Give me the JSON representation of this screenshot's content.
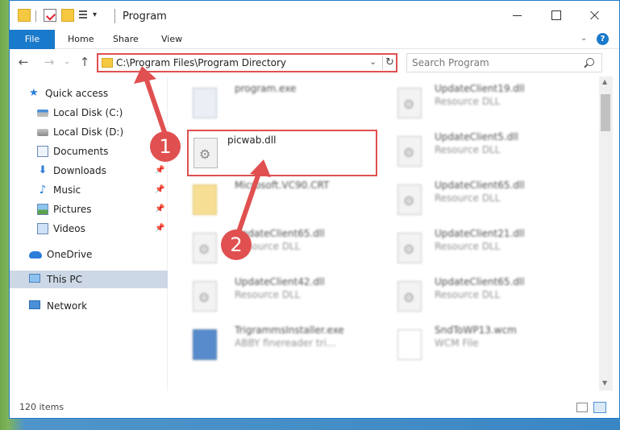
{
  "window": {
    "title": "Program",
    "quick_access_dropdown": "▾"
  },
  "ribbon": {
    "tabs": [
      {
        "label": "File"
      },
      {
        "label": "Home"
      },
      {
        "label": "Share"
      },
      {
        "label": "View"
      }
    ],
    "expand": "⌄",
    "help": "?"
  },
  "nav": {
    "back": "←",
    "forward": "→",
    "recent": "⌄",
    "up": "↑",
    "address": "C:\\Program Files\\Program Directory",
    "address_chevron": "⌄",
    "refresh": "↻",
    "search_placeholder": "Search Program"
  },
  "sidebar": {
    "items": [
      {
        "label": "Quick access",
        "icon": "star-icon"
      },
      {
        "label": "Local Disk (C:)",
        "icon": "disk-icon"
      },
      {
        "label": "Local Disk (D:)",
        "icon": "disk-icon"
      },
      {
        "label": "Documents",
        "icon": "documents-icon"
      },
      {
        "label": "Downloads",
        "icon": "downloads-icon",
        "pinned": "📌"
      },
      {
        "label": "Music",
        "icon": "music-icon",
        "pinned": "📌"
      },
      {
        "label": "Pictures",
        "icon": "pictures-icon",
        "pinned": "📌"
      },
      {
        "label": "Videos",
        "icon": "videos-icon",
        "pinned": "📌"
      },
      {
        "label": "OneDrive",
        "icon": "cloud-icon"
      },
      {
        "label": "This PC",
        "icon": "pc-icon"
      },
      {
        "label": "Network",
        "icon": "network-icon"
      }
    ]
  },
  "files": {
    "left": [
      {
        "name": "program.exe",
        "type": ""
      },
      {
        "name": "picwab.dll",
        "type": ""
      },
      {
        "name": "Microsoft.VC90.CRT",
        "type": ""
      },
      {
        "name": "UpdateClient65.dll",
        "type": "Resource DLL"
      },
      {
        "name": "UpdateClient42.dll",
        "type": "Resource DLL"
      },
      {
        "name": "TrigrammsInstaller.exe",
        "type": "ABBY finereader tri..."
      }
    ],
    "right": [
      {
        "name": "UpdateClient19.dll",
        "type": "Resource DLL"
      },
      {
        "name": "UpdateClient5.dll",
        "type": "Resource DLL"
      },
      {
        "name": "UpdateClient65.dll",
        "type": "Resource DLL"
      },
      {
        "name": "UpdateClient21.dll",
        "type": "Resource DLL"
      },
      {
        "name": "UpdateClient65.dll",
        "type": "Resource DLL"
      },
      {
        "name": "SndToWP13.wcm",
        "type": "WCM File"
      }
    ]
  },
  "scrollbar": {
    "up": "▲",
    "down": "▼"
  },
  "status": {
    "count": "120 items"
  },
  "annotations": {
    "marker1": "1",
    "marker2": "2",
    "color": "#e05050"
  },
  "colors": {
    "accent": "#1979ca",
    "highlight": "#e05050",
    "selected": "#ccd8e6"
  }
}
